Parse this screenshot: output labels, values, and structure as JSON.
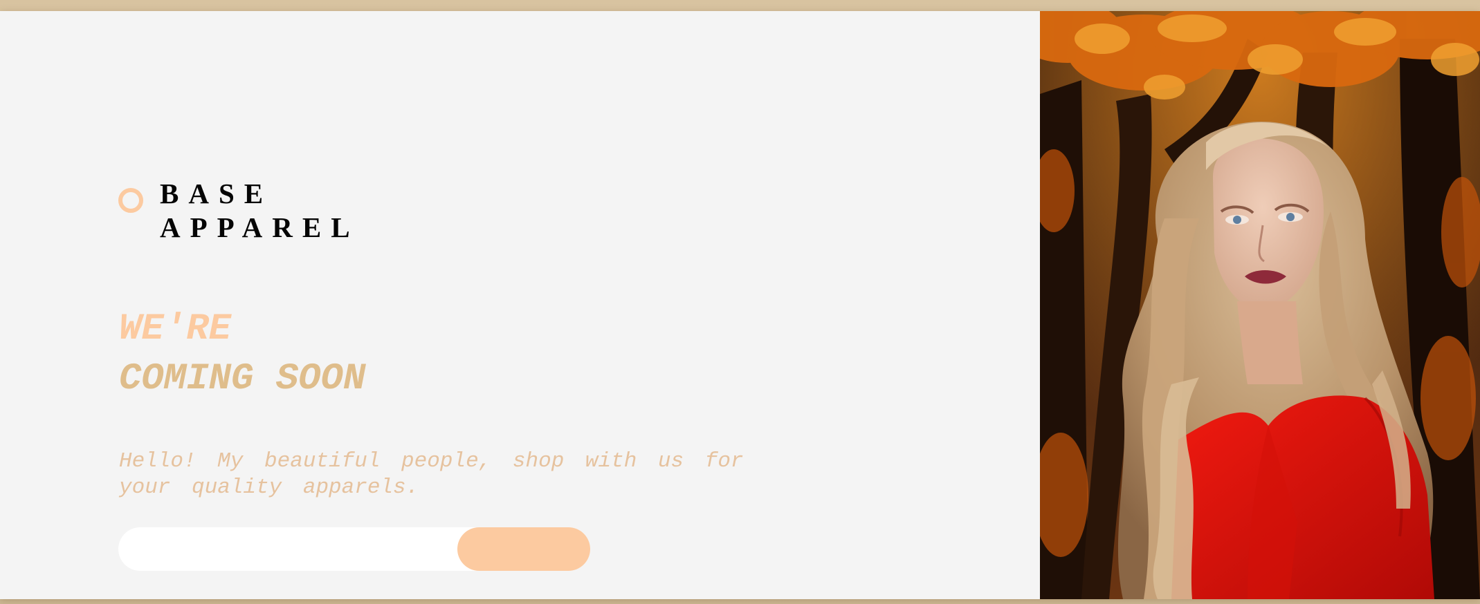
{
  "brand": {
    "name_line1": "BASE",
    "name_line2": "APPAREL",
    "accent_color": "#fccaa0",
    "logo_icon": "ring-icon"
  },
  "headline": {
    "line1": "WE'RE",
    "line2": "COMING SOON",
    "line1_color": "#fccaa0",
    "line2_color": "#dfbd8b"
  },
  "intro": {
    "line1": "Hello! My beautiful people, shop with us for",
    "line2": "your quality apparels."
  },
  "signup": {
    "email_placeholder": "",
    "button_color": "#fccaa0",
    "submit_icon": "arrow-right-icon"
  },
  "hero": {
    "image_description": "Woman with long curly blonde hair in a red sweater in an autumn forest"
  },
  "colors": {
    "panel_background": "#f4f4f4",
    "page_frame": "#d8c3a0"
  }
}
